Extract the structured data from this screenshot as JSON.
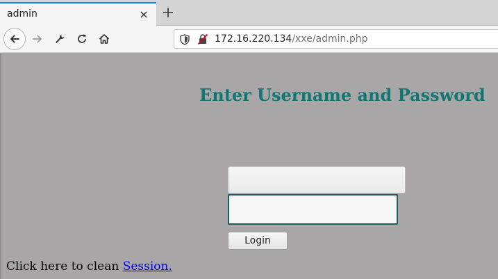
{
  "browser": {
    "tab": {
      "title": "admin",
      "close_icon": "close-icon"
    },
    "new_tab_icon": "plus-icon",
    "nav": {
      "back_icon": "arrow-left-icon",
      "forward_icon": "arrow-right-icon",
      "tools_icon": "wrench-icon",
      "reload_icon": "reload-icon",
      "home_icon": "home-icon"
    },
    "url": {
      "host": "172.16.220.134",
      "path": "/xxe/admin.php",
      "shield_icon": "shield-icon",
      "insecure_icon": "insecure-lock-icon"
    }
  },
  "page": {
    "heading": "Enter Username and Password",
    "username_value": "",
    "password_value": "",
    "login_label": "Login",
    "session_text": "Click here to clean ",
    "session_link": "Session.",
    "colors": {
      "background": "#a8a6a6",
      "heading": "#127774",
      "link": "#0000ee"
    }
  }
}
